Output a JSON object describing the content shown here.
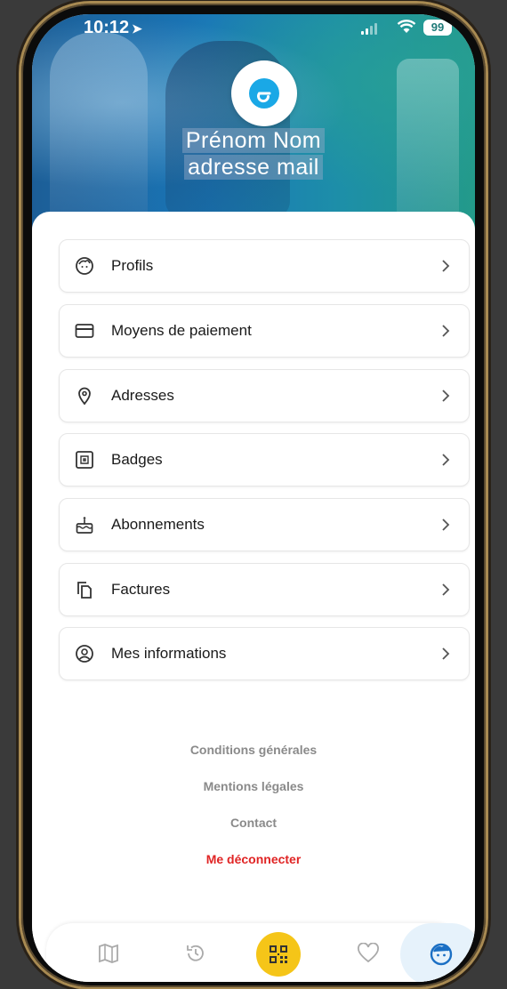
{
  "status": {
    "time": "10:12",
    "battery": "99"
  },
  "header": {
    "name": "Prénom Nom",
    "email": "adresse mail"
  },
  "menu": [
    {
      "label": "Profils",
      "icon": "profile-face-icon"
    },
    {
      "label": "Moyens de paiement",
      "icon": "credit-card-icon"
    },
    {
      "label": "Adresses",
      "icon": "location-pin-icon"
    },
    {
      "label": "Badges",
      "icon": "badge-icon"
    },
    {
      "label": "Abonnements",
      "icon": "cake-icon"
    },
    {
      "label": "Factures",
      "icon": "documents-icon"
    },
    {
      "label": "Mes informations",
      "icon": "user-circle-icon"
    }
  ],
  "footer": {
    "terms": "Conditions générales",
    "legal": "Mentions légales",
    "contact": "Contact",
    "logout": "Me déconnecter"
  },
  "tabs": [
    {
      "icon": "map-icon"
    },
    {
      "icon": "history-icon"
    },
    {
      "icon": "qr-code-icon"
    },
    {
      "icon": "heart-icon"
    },
    {
      "icon": "profile-face-icon",
      "active": true
    }
  ],
  "colors": {
    "accent": "#1aa8e6",
    "logout": "#e02424",
    "qr_button": "#f5c518",
    "active_tab_bg": "#e6f2fb"
  }
}
